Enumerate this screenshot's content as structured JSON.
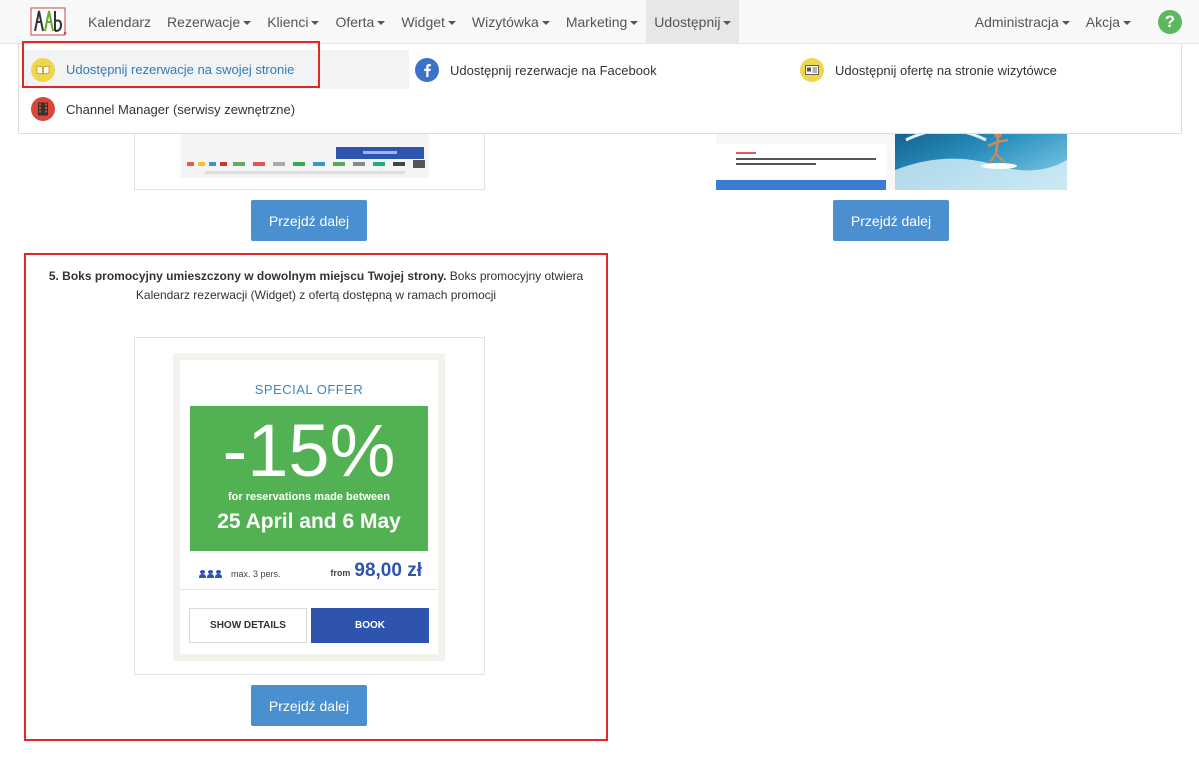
{
  "nav": {
    "items": [
      {
        "label": "Kalendarz",
        "caret": false
      },
      {
        "label": "Rezerwacje",
        "caret": true
      },
      {
        "label": "Klienci",
        "caret": true
      },
      {
        "label": "Oferta",
        "caret": true
      },
      {
        "label": "Widget",
        "caret": true
      },
      {
        "label": "Wizytówka",
        "caret": true
      },
      {
        "label": "Marketing",
        "caret": true
      },
      {
        "label": "Udostępnij",
        "caret": true,
        "active": true
      }
    ],
    "right_items": [
      {
        "label": "Administracja",
        "caret": true
      },
      {
        "label": "Akcja",
        "caret": true
      }
    ],
    "help_symbol": "?",
    "help_icon": "question-circle-icon",
    "help_color": "#5cb85c"
  },
  "dropdown": {
    "item1": {
      "label": "Udostępnij rezerwacje na swojej stronie",
      "icon": "book-icon"
    },
    "item2": {
      "label": "Udostępnij rezerwacje na Facebook",
      "icon": "facebook-icon"
    },
    "item3": {
      "label": "Udostępnij ofertę na stronie wizytówce",
      "icon": "card-icon"
    },
    "item4": {
      "label": "Channel Manager (serwisy zewnętrzne)",
      "icon": "film-strip-icon"
    }
  },
  "buttons": {
    "next_label": "Przejdź dalej"
  },
  "section5": {
    "title_bold": "5. Boks promocyjny umieszczony w dowolnym miejscu Twojej strony.",
    "description": " Boks promocyjny otwiera Kalendarz rezerwacji (Widget) z ofertą dostępną w ramach promocji"
  },
  "widget": {
    "heading": "SPECIAL OFFER",
    "discount": "-15%",
    "for_reservations": "for reservations made between",
    "date_range": "25 April and 6 May",
    "persons": "max. 3 pers.",
    "price_from": "from",
    "price": "98,00 zł",
    "show_details": "SHOW DETAILS",
    "book": "BOOK"
  },
  "colors": {
    "accent_blue": "#4a8fd0",
    "highlight_red": "#e32626",
    "offer_green": "#52b152",
    "book_blue": "#2f54b0"
  }
}
